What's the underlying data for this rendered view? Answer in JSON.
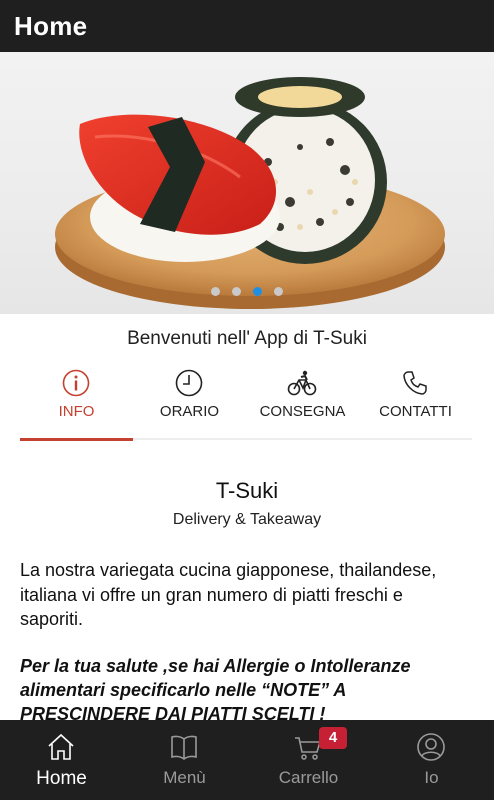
{
  "topbar": {
    "title": "Home"
  },
  "hero": {
    "image_alt": "sushi",
    "slides": 4,
    "active_slide": 3
  },
  "welcome": "Benvenuti nell' App di T-Suki",
  "tabs": [
    {
      "label": "INFO",
      "icon": "info-icon"
    },
    {
      "label": "ORARIO",
      "icon": "clock-icon"
    },
    {
      "label": "CONSEGNA",
      "icon": "bicycle-icon"
    },
    {
      "label": "CONTATTI",
      "icon": "phone-icon"
    }
  ],
  "info": {
    "name": "T-Suki",
    "subtitle": "Delivery & Takeaway",
    "description": "La nostra variegata cucina giapponese, thailandese, italiana vi offre un gran numero di piatti freschi e saporiti.",
    "warning": "Per la tua salute ,se hai Allergie o Intolleranze alimentari specificarlo nelle “NOTE” A PRESCINDERE DAI PIATTI SCELTI !"
  },
  "bottom_nav": [
    {
      "label": "Home",
      "icon": "home-icon"
    },
    {
      "label": "Menù",
      "icon": "book-icon"
    },
    {
      "label": "Carrello",
      "icon": "cart-icon",
      "badge": "4"
    },
    {
      "label": "Io",
      "icon": "user-icon"
    }
  ],
  "colors": {
    "accent": "#c4402f",
    "bar": "#1f1f1f",
    "badge": "#c62035",
    "dot_active": "#1f8fe3"
  }
}
